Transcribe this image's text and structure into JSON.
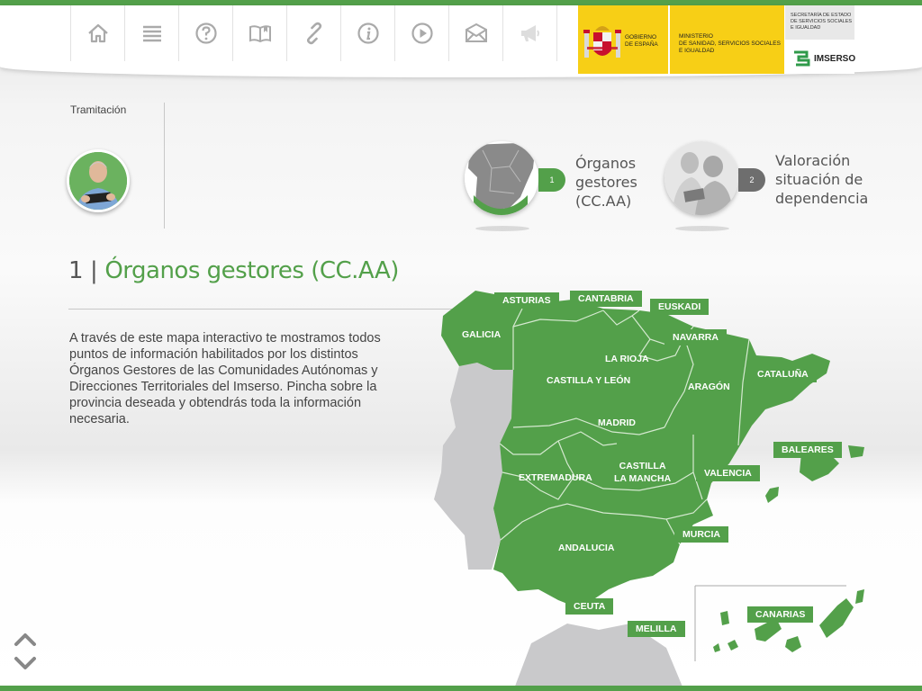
{
  "toolbar": {
    "buttons": [
      {
        "name": "home-button",
        "icon": "home-icon"
      },
      {
        "name": "menu-button",
        "icon": "list-icon"
      },
      {
        "name": "help-button",
        "icon": "question-icon"
      },
      {
        "name": "guide-button",
        "icon": "book-icon"
      },
      {
        "name": "links-button",
        "icon": "link-icon"
      },
      {
        "name": "info-button",
        "icon": "info-icon"
      },
      {
        "name": "video-button",
        "icon": "play-icon"
      },
      {
        "name": "contact-button",
        "icon": "mail-icon"
      },
      {
        "name": "news-button",
        "icon": "megaphone-icon"
      }
    ]
  },
  "logos": {
    "gobierno_line1": "GOBIERNO",
    "gobierno_line2": "DE ESPAÑA",
    "ministerio_line1": "MINISTERIO",
    "ministerio_line2": "DE SANIDAD, SERVICIOS SOCIALES",
    "ministerio_line3": "E IGUALDAD",
    "secretaria_line1": "SECRETARÍA DE ESTADO",
    "secretaria_line2": "DE SERVICIOS SOCIALES",
    "secretaria_line3": "E IGUALDAD",
    "imserso": "IMSERSO"
  },
  "section_label": "Tramitación",
  "steps": [
    {
      "number": "1",
      "line1": "Órganos",
      "line2": "gestores",
      "line3": "(CC.AA)",
      "active": true
    },
    {
      "number": "2",
      "line1": "Valoración",
      "line2": "situación de",
      "line3": "dependencia",
      "active": false
    }
  ],
  "content": {
    "number": "1",
    "separator": "|",
    "title": "Órganos gestores (CC.AA)",
    "description": "A través de este mapa interactivo te mostramos todos puntos de información habilitados por los distintos Órganos Gestores de las Comunidades Autónomas y Direcciones Territoriales del Imserso. Pincha sobre la provincia deseada y obtendrás toda la información necesaria."
  },
  "map": {
    "tag_regions": [
      "ASTURIAS",
      "CANTABRIA",
      "EUSKADI",
      "GALICIA",
      "NAVARRA",
      "CATALUÑA",
      "BALEARES",
      "VALENCIA",
      "MURCIA",
      "CEUTA",
      "MELILLA",
      "CANARIAS"
    ],
    "inline_regions": {
      "la_rioja": "LA RIOJA",
      "castilla_leon": "CASTILLA Y LEÓN",
      "aragon": "ARAGÓN",
      "madrid": "MADRID",
      "castilla_mancha_1": "CASTILLA",
      "castilla_mancha_2": "LA MANCHA",
      "extremadura": "EXTREMADURA",
      "andalucia": "ANDALUCIA"
    }
  },
  "colors": {
    "accent": "#53a04a",
    "badge_inactive": "#6e6e6e",
    "portugal": "#c9c9cb",
    "gob_yellow": "#f7cf16"
  }
}
